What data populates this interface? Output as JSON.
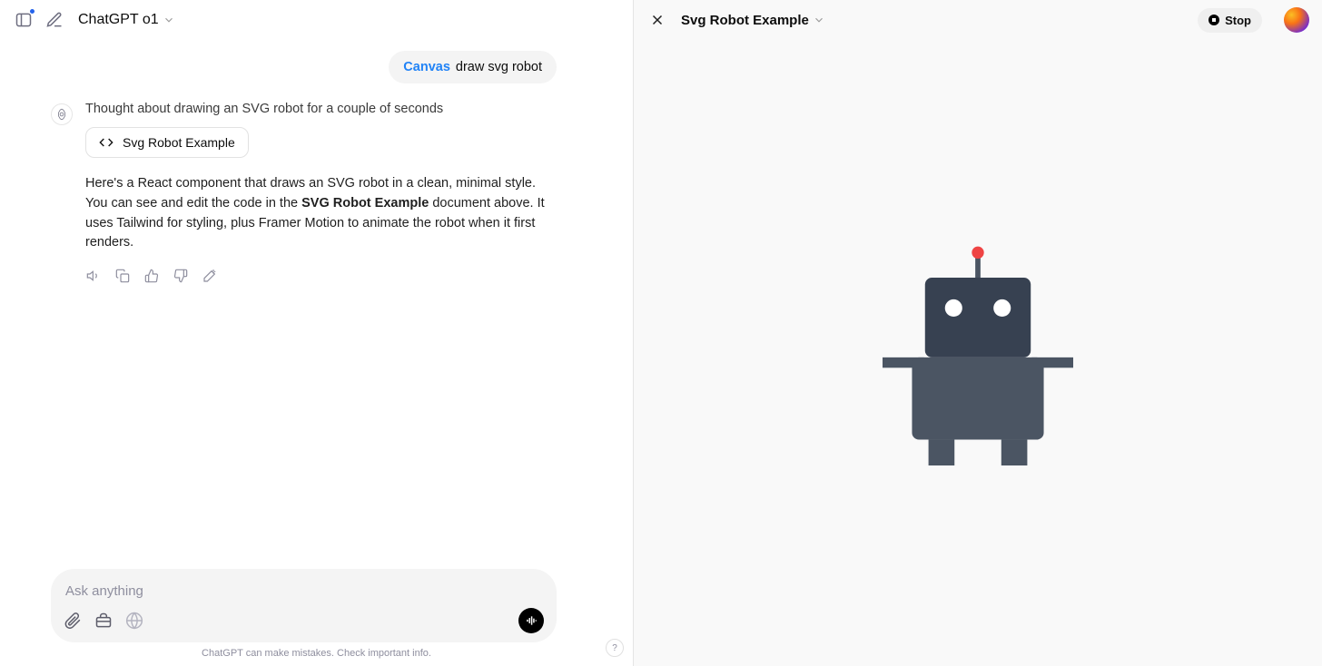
{
  "header": {
    "model_label": "ChatGPT o1"
  },
  "conversation": {
    "user_message": {
      "prefix": "Canvas",
      "text": "draw  svg robot"
    },
    "assistant": {
      "thought": "Thought about drawing an SVG robot for a couple of seconds",
      "artifact_title": "Svg Robot Example",
      "body_before": "Here's a React component that draws an SVG robot in a clean, minimal style. You can see and edit the code in the ",
      "body_bold": "SVG Robot Example",
      "body_after": " document above. It uses Tailwind for styling, plus Framer Motion to animate the robot when it first renders."
    }
  },
  "composer": {
    "placeholder": "Ask anything"
  },
  "footer": {
    "disclaimer": "ChatGPT can make mistakes. Check important info."
  },
  "canvas_panel": {
    "title": "Svg Robot Example",
    "stop_label": "Stop"
  },
  "help_label": "?"
}
